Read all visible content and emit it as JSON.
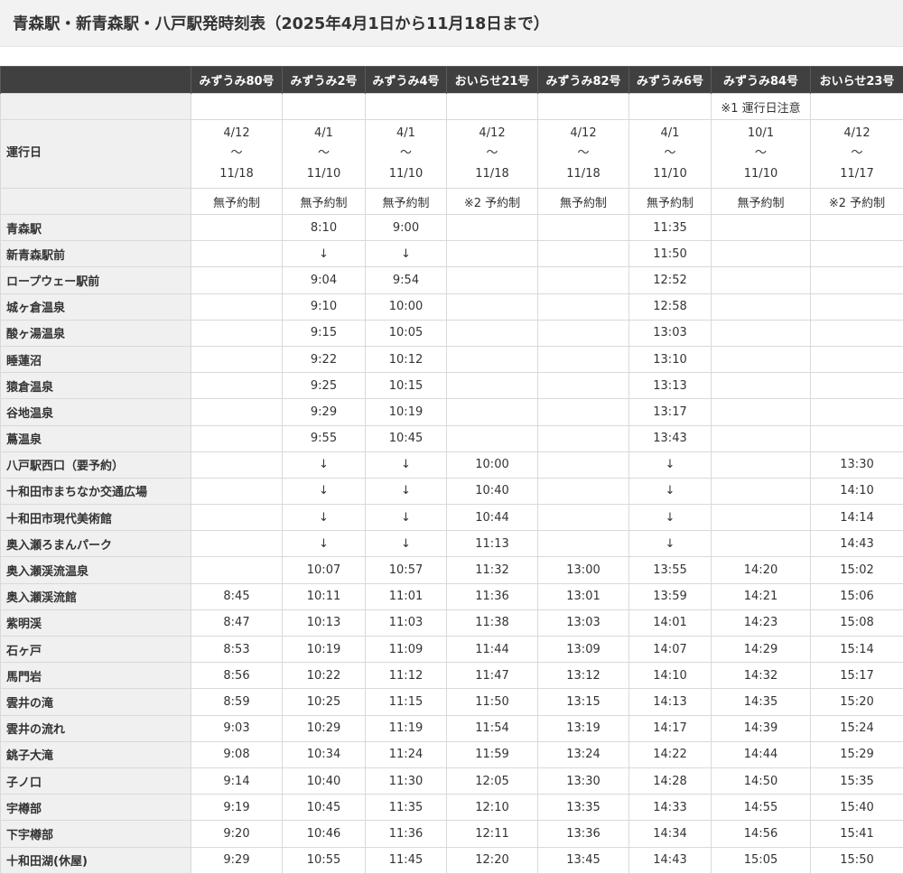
{
  "page_title": "青森駅・新青森駅・八戸駅発時刻表（2025年4月1日から11月18日まで）",
  "columns": [
    "みずうみ80号",
    "みずうみ2号",
    "みずうみ4号",
    "おいらせ21号",
    "みずうみ82号",
    "みずうみ6号",
    "みずうみ84号",
    "おいらせ23号"
  ],
  "notes": [
    "",
    "",
    "",
    "",
    "",
    "",
    "※1 運行日注意",
    ""
  ],
  "operation_label": "運行日",
  "dates": [
    {
      "from": "4/12",
      "sep": "～",
      "to": "11/18"
    },
    {
      "from": "4/1",
      "sep": "～",
      "to": "11/10"
    },
    {
      "from": "4/1",
      "sep": "～",
      "to": "11/10"
    },
    {
      "from": "4/12",
      "sep": "～",
      "to": "11/18"
    },
    {
      "from": "4/12",
      "sep": "～",
      "to": "11/18"
    },
    {
      "from": "4/1",
      "sep": "～",
      "to": "11/10"
    },
    {
      "from": "10/1",
      "sep": "～",
      "to": "11/10"
    },
    {
      "from": "4/12",
      "sep": "～",
      "to": "11/17"
    }
  ],
  "reservation": [
    "無予約制",
    "無予約制",
    "無予約制",
    "※2 予約制",
    "無予約制",
    "無予約制",
    "無予約制",
    "※2 予約制"
  ],
  "stops": [
    {
      "name": "青森駅",
      "times": [
        "",
        "8:10",
        "9:00",
        "",
        "",
        "11:35",
        "",
        ""
      ]
    },
    {
      "name": "新青森駅前",
      "times": [
        "",
        "↓",
        "↓",
        "",
        "",
        "11:50",
        "",
        ""
      ]
    },
    {
      "name": "ロープウェー駅前",
      "times": [
        "",
        "9:04",
        "9:54",
        "",
        "",
        "12:52",
        "",
        ""
      ]
    },
    {
      "name": "城ヶ倉温泉",
      "times": [
        "",
        "9:10",
        "10:00",
        "",
        "",
        "12:58",
        "",
        ""
      ]
    },
    {
      "name": "酸ヶ湯温泉",
      "times": [
        "",
        "9:15",
        "10:05",
        "",
        "",
        "13:03",
        "",
        ""
      ]
    },
    {
      "name": "睡蓮沼",
      "times": [
        "",
        "9:22",
        "10:12",
        "",
        "",
        "13:10",
        "",
        ""
      ]
    },
    {
      "name": "猿倉温泉",
      "times": [
        "",
        "9:25",
        "10:15",
        "",
        "",
        "13:13",
        "",
        ""
      ]
    },
    {
      "name": "谷地温泉",
      "times": [
        "",
        "9:29",
        "10:19",
        "",
        "",
        "13:17",
        "",
        ""
      ]
    },
    {
      "name": "蔦温泉",
      "times": [
        "",
        "9:55",
        "10:45",
        "",
        "",
        "13:43",
        "",
        ""
      ]
    },
    {
      "name": "八戸駅西口（要予約）",
      "times": [
        "",
        "↓",
        "↓",
        "10:00",
        "",
        "↓",
        "",
        "13:30"
      ]
    },
    {
      "name": "十和田市まちなか交通広場",
      "times": [
        "",
        "↓",
        "↓",
        "10:40",
        "",
        "↓",
        "",
        "14:10"
      ]
    },
    {
      "name": "十和田市現代美術館",
      "times": [
        "",
        "↓",
        "↓",
        "10:44",
        "",
        "↓",
        "",
        "14:14"
      ]
    },
    {
      "name": "奥入瀬ろまんパーク",
      "times": [
        "",
        "↓",
        "↓",
        "11:13",
        "",
        "↓",
        "",
        "14:43"
      ]
    },
    {
      "name": "奥入瀬渓流温泉",
      "times": [
        "",
        "10:07",
        "10:57",
        "11:32",
        "13:00",
        "13:55",
        "14:20",
        "15:02"
      ]
    },
    {
      "name": "奥入瀬渓流館",
      "times": [
        "8:45",
        "10:11",
        "11:01",
        "11:36",
        "13:01",
        "13:59",
        "14:21",
        "15:06"
      ]
    },
    {
      "name": "紫明渓",
      "times": [
        "8:47",
        "10:13",
        "11:03",
        "11:38",
        "13:03",
        "14:01",
        "14:23",
        "15:08"
      ]
    },
    {
      "name": "石ヶ戸",
      "times": [
        "8:53",
        "10:19",
        "11:09",
        "11:44",
        "13:09",
        "14:07",
        "14:29",
        "15:14"
      ]
    },
    {
      "name": "馬門岩",
      "times": [
        "8:56",
        "10:22",
        "11:12",
        "11:47",
        "13:12",
        "14:10",
        "14:32",
        "15:17"
      ]
    },
    {
      "name": "雲井の滝",
      "times": [
        "8:59",
        "10:25",
        "11:15",
        "11:50",
        "13:15",
        "14:13",
        "14:35",
        "15:20"
      ]
    },
    {
      "name": "雲井の流れ",
      "times": [
        "9:03",
        "10:29",
        "11:19",
        "11:54",
        "13:19",
        "14:17",
        "14:39",
        "15:24"
      ]
    },
    {
      "name": "銚子大滝",
      "times": [
        "9:08",
        "10:34",
        "11:24",
        "11:59",
        "13:24",
        "14:22",
        "14:44",
        "15:29"
      ]
    },
    {
      "name": "子ノ口",
      "times": [
        "9:14",
        "10:40",
        "11:30",
        "12:05",
        "13:30",
        "14:28",
        "14:50",
        "15:35"
      ]
    },
    {
      "name": "宇樽部",
      "times": [
        "9:19",
        "10:45",
        "11:35",
        "12:10",
        "13:35",
        "14:33",
        "14:55",
        "15:40"
      ]
    },
    {
      "name": "下宇樽部",
      "times": [
        "9:20",
        "10:46",
        "11:36",
        "12:11",
        "13:36",
        "14:34",
        "14:56",
        "15:41"
      ]
    },
    {
      "name": "十和田湖(休屋)",
      "times": [
        "9:29",
        "10:55",
        "11:45",
        "12:20",
        "13:45",
        "14:43",
        "15:05",
        "15:50"
      ]
    }
  ]
}
